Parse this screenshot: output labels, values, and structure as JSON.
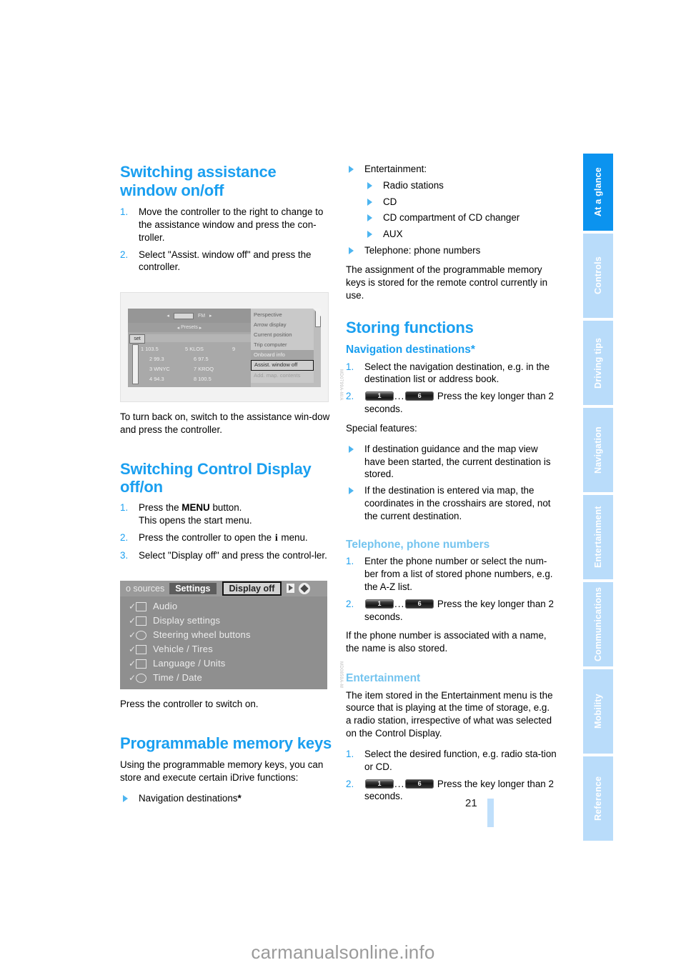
{
  "page": {
    "number": "21",
    "watermark": "carmanualsonline.info"
  },
  "sidebar": {
    "tabs": [
      {
        "label": "At a glance",
        "active": true
      },
      {
        "label": "Controls",
        "active": false
      },
      {
        "label": "Driving tips",
        "active": false
      },
      {
        "label": "Navigation",
        "active": false
      },
      {
        "label": "Entertainment",
        "active": false
      },
      {
        "label": "Communications",
        "active": false
      },
      {
        "label": "Mobility",
        "active": false
      },
      {
        "label": "Reference",
        "active": false
      }
    ]
  },
  "left_column": {
    "heading_assistance": "Switching assistance window on/off",
    "steps_assistance": [
      {
        "num": "1.",
        "text": "Move the controller to the right to change to the assistance window and press the con-troller."
      },
      {
        "num": "2.",
        "text": "Select \"Assist. window off\" and press the controller."
      }
    ],
    "figure_radio": {
      "band": "FM",
      "presets_label": "Presets",
      "set_label": "set",
      "stations": [
        {
          "left_num": "1",
          "left_freq": "103.5",
          "mid_num": "5",
          "mid_name": "KLOS",
          "right_num": "9"
        },
        {
          "left_num": "2",
          "left_freq": "99.3",
          "mid_num": "6",
          "mid_name": "97.5",
          "right_num": ""
        },
        {
          "left_num": "3",
          "left_freq": "WNYC",
          "mid_num": "7",
          "mid_name": "KROQ",
          "right_num": ""
        },
        {
          "left_num": "4",
          "left_freq": "94.3",
          "mid_num": "8",
          "mid_name": "100.5",
          "right_num": ""
        }
      ],
      "menu_items": [
        "Perspective",
        "Arrow display",
        "Current position",
        "Trip computer",
        "Onboard info",
        "Assist. window off",
        "Add. map. contents"
      ]
    },
    "para_turn_back_on": "To turn back on, switch to the assistance win-dow and press the controller.",
    "heading_control_display": "Switching Control Display off/on",
    "steps_control_display": [
      {
        "num": "1.",
        "pre": "Press the ",
        "bold": "MENU",
        "post": " button.",
        "second_line": "This opens the start menu."
      },
      {
        "num": "2.",
        "pre": "Press the controller to open the ",
        "glyph": "i",
        "post": " menu."
      },
      {
        "num": "3.",
        "text": "Select \"Display off\" and press the control-ler."
      }
    ],
    "figure_settings": {
      "tab_sources": "o sources",
      "tab_settings": "Settings",
      "tab_display_off": "Display off",
      "items": [
        "Audio",
        "Display settings",
        "Steering wheel buttons",
        "Vehicle / Tires",
        "Language / Units",
        "Time / Date"
      ]
    },
    "para_switch_on": "Press the controller to switch on.",
    "heading_memory_keys": "Programmable memory keys",
    "para_memory_intro": "Using the programmable memory keys, you can store and execute certain iDrive functions:",
    "bullet_nav": "Navigation destinations",
    "bullet_nav_star": "*"
  },
  "right_column": {
    "bullet_entertainment": "Entertainment:",
    "entertainment_sub": [
      "Radio stations",
      "CD",
      "CD compartment of CD changer",
      "AUX"
    ],
    "bullet_telephone": "Telephone: phone numbers",
    "para_assignment": "The assignment of the programmable memory keys is stored for the remote control currently in use.",
    "heading_storing": "Storing functions",
    "heading_nav_dest": "Navigation destinations*",
    "nav_steps": [
      {
        "num": "1.",
        "text": "Select the navigation destination, e.g. in the destination list or address book."
      },
      {
        "num": "2.",
        "key_first": "1",
        "ellipsis": "...",
        "key_last": "6",
        "text": "Press the key longer than 2 seconds."
      }
    ],
    "special_features_label": "Special features:",
    "special_features": [
      "If destination guidance and the map view have been started, the current destination is stored.",
      "If the destination is entered via map, the coordinates in the crosshairs are stored, not the current destination."
    ],
    "heading_telephone": "Telephone, phone numbers",
    "telephone_steps": [
      {
        "num": "1.",
        "text": "Enter the phone number or select the num-ber from a list of stored phone numbers, e.g. the A-Z list."
      },
      {
        "num": "2.",
        "key_first": "1",
        "ellipsis": "...",
        "key_last": "6",
        "text": "Press the key longer than 2 seconds."
      }
    ],
    "para_phone_name": "If the phone number is associated with a name, the name is also stored.",
    "heading_entertainment": "Entertainment",
    "para_entertainment": "The item stored in the Entertainment menu is the source that is playing at the time of storage, e.g. a radio station, irrespective of what was selected on the Control Display.",
    "entertainment_steps": [
      {
        "num": "1.",
        "text": "Select the desired function, e.g. radio sta-tion or CD."
      },
      {
        "num": "2.",
        "key_first": "1",
        "ellipsis": "...",
        "key_last": "6",
        "text": "Press the key longer than 2 seconds."
      }
    ]
  },
  "colors": {
    "accent_blue": "#1a9ff0",
    "light_blue": "#74c4ef",
    "tab_active": "#0b93ef",
    "tab_inactive": "#b9dcfa"
  }
}
